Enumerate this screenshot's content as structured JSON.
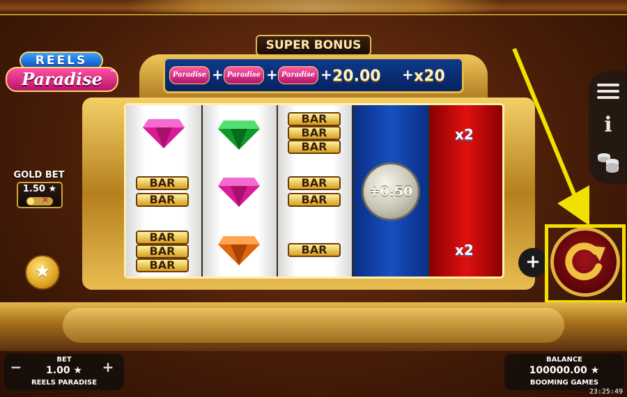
{
  "game": {
    "logo_top": "REELS",
    "logo_bottom": "Paradise",
    "logo_tm": "™"
  },
  "super_bonus": {
    "label": "SUPER BONUS",
    "mini_logo": "Paradise",
    "plus": "+",
    "amount": "20.00",
    "multiplier": "x20"
  },
  "gold_bet": {
    "label": "GOLD BET",
    "value": "1.50 ★",
    "toggle_off": "✕"
  },
  "reels": {
    "bar_label": "BAR",
    "coin_value": "+0.50",
    "multiplier_top": "x2",
    "multiplier_bottom": "x2"
  },
  "bet": {
    "label": "BET",
    "value": "1.00 ★",
    "game_name": "REELS PARADISE",
    "minus": "−",
    "plus": "+"
  },
  "balance": {
    "label": "BALANCE",
    "value": "100000.00 ★",
    "provider": "BOOMING GAMES"
  },
  "controls": {
    "star": "★",
    "plus": "+",
    "info": "i"
  },
  "clock": "23:25:49",
  "colors": {
    "gold": "#e8b84a",
    "highlight": "#f2e000",
    "reel_blue": "#1650c0",
    "reel_red": "#e01010"
  }
}
